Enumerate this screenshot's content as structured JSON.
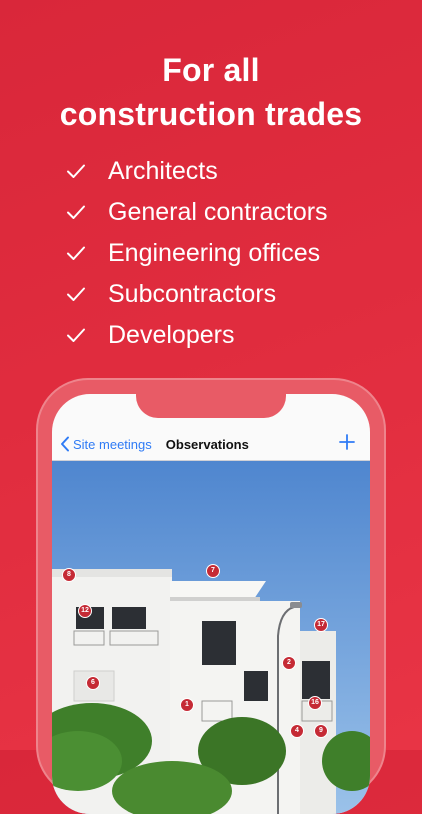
{
  "headline": {
    "line1": "For all",
    "line2": "construction trades"
  },
  "trades": [
    {
      "label": "Architects"
    },
    {
      "label": "General contractors"
    },
    {
      "label": "Engineering offices"
    },
    {
      "label": "Subcontractors"
    },
    {
      "label": "Developers"
    }
  ],
  "app": {
    "back_label": "Site meetings",
    "title": "Observations",
    "add_icon": "plus-icon",
    "accent_color": "#2f7bf5"
  },
  "pins": [
    {
      "number": "8"
    },
    {
      "number": "7"
    },
    {
      "number": "12"
    },
    {
      "number": "17"
    },
    {
      "number": "2"
    },
    {
      "number": "6"
    },
    {
      "number": "1"
    },
    {
      "number": "16"
    },
    {
      "number": "4"
    },
    {
      "number": "9"
    }
  ],
  "colors": {
    "background": "#e02c3e",
    "pin": "#c52a35"
  }
}
